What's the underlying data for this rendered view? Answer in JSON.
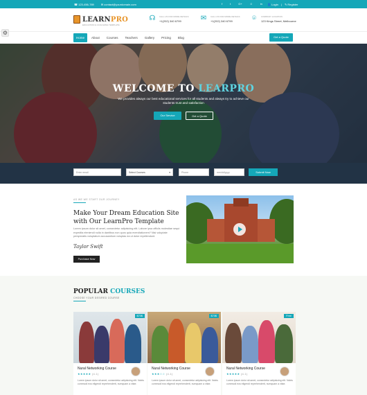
{
  "topbar": {
    "phone": "123-456-789",
    "email": "contact@yourdomain.com",
    "social": [
      "f",
      "t",
      "G+",
      "☺",
      "in"
    ],
    "login": "Login",
    "register": "Register"
  },
  "header": {
    "logo_main": "LEARN",
    "logo_accent": "PRO",
    "logo_tagline": "EDUCATION & COACHING TEMPLATE",
    "contacts": [
      {
        "icon": "headset-icon",
        "label": "CALL US FOR MORE DETAILS",
        "value": "+1(202) 340 6799"
      },
      {
        "icon": "envelope-icon",
        "label": "CALL US FOR MORE DETAILS",
        "value": "+1(202) 340 6799"
      },
      {
        "icon": "location-pin-icon",
        "label": "COMPANY LOCATION",
        "value": "123 Kings Street, Melbourne"
      }
    ]
  },
  "nav": {
    "items": [
      "Home",
      "About",
      "Courses",
      "Teachers",
      "Gallery",
      "Pricing",
      "Blog"
    ],
    "active": "Home",
    "cta": "Get a Quote"
  },
  "hero": {
    "title_main": "WELCOME TO ",
    "title_accent": "LEARPRO",
    "subtitle": "We provides always our best educational services for all students and always try to achieve our students trust and satisfaction",
    "btn_primary": "Our Service",
    "btn_secondary": "Get a Quote"
  },
  "search": {
    "email_placeholder": "Enter email",
    "course_select": "Select Courses",
    "phone_placeholder": "Phone",
    "date_placeholder": "mm/dd/yyyy",
    "button": "Submit Now"
  },
  "about": {
    "kicker": "AS WE WE START OUR JOURNEY",
    "title": "Make Your Dream Education Site with Our LearnPro Template",
    "text": "Lorem ipsum dolor sit amet, consectetur adipisicing elit. Labore ipsa officiis molestiae sequi expedita eleniendi nulla in dantibus non quos quia exercitationem? Nisi voluptate perspiciatis voluptatum accusantium voluptas ea ut dolor repellendunt.",
    "signature": "Taylor Swift",
    "button": "Purchase Now"
  },
  "courses": {
    "title_main": "POPULAR ",
    "title_accent": "COURSES",
    "subtitle": "CHOOSE YOUR DESIRED COURSE",
    "items": [
      {
        "price": "$70$",
        "title": "Nural Networking Course",
        "stars": "★★★★★",
        "count": "(4.1)",
        "desc": "Lorem ipsum dolor sit amet, consectetur adipisicing elit. Nobis commodi eos eligendi reprehenderit, numquam a vitae."
      },
      {
        "price": "$70$",
        "title": "Nural Networking Course",
        "stars": "★★★☆☆",
        "count": "(4.1)",
        "desc": "Lorem ipsum dolor sit amet, consectetur adipisicing elit. Nobis commodi eos eligendi reprehenderit, numquam a vitae."
      },
      {
        "price": "Free",
        "title": "Nural Networking Course",
        "stars": "★★★★★",
        "count": "(4.1)",
        "desc": "Lorem ipsum dolor sit amet, consectetur adipisicing elit. Nobis commodi eos eligendi reprehenderit, numquam a vitae."
      }
    ]
  },
  "colors": {
    "accent": "#15a7b8",
    "dark": "#223345",
    "logo": "#e8952a"
  }
}
